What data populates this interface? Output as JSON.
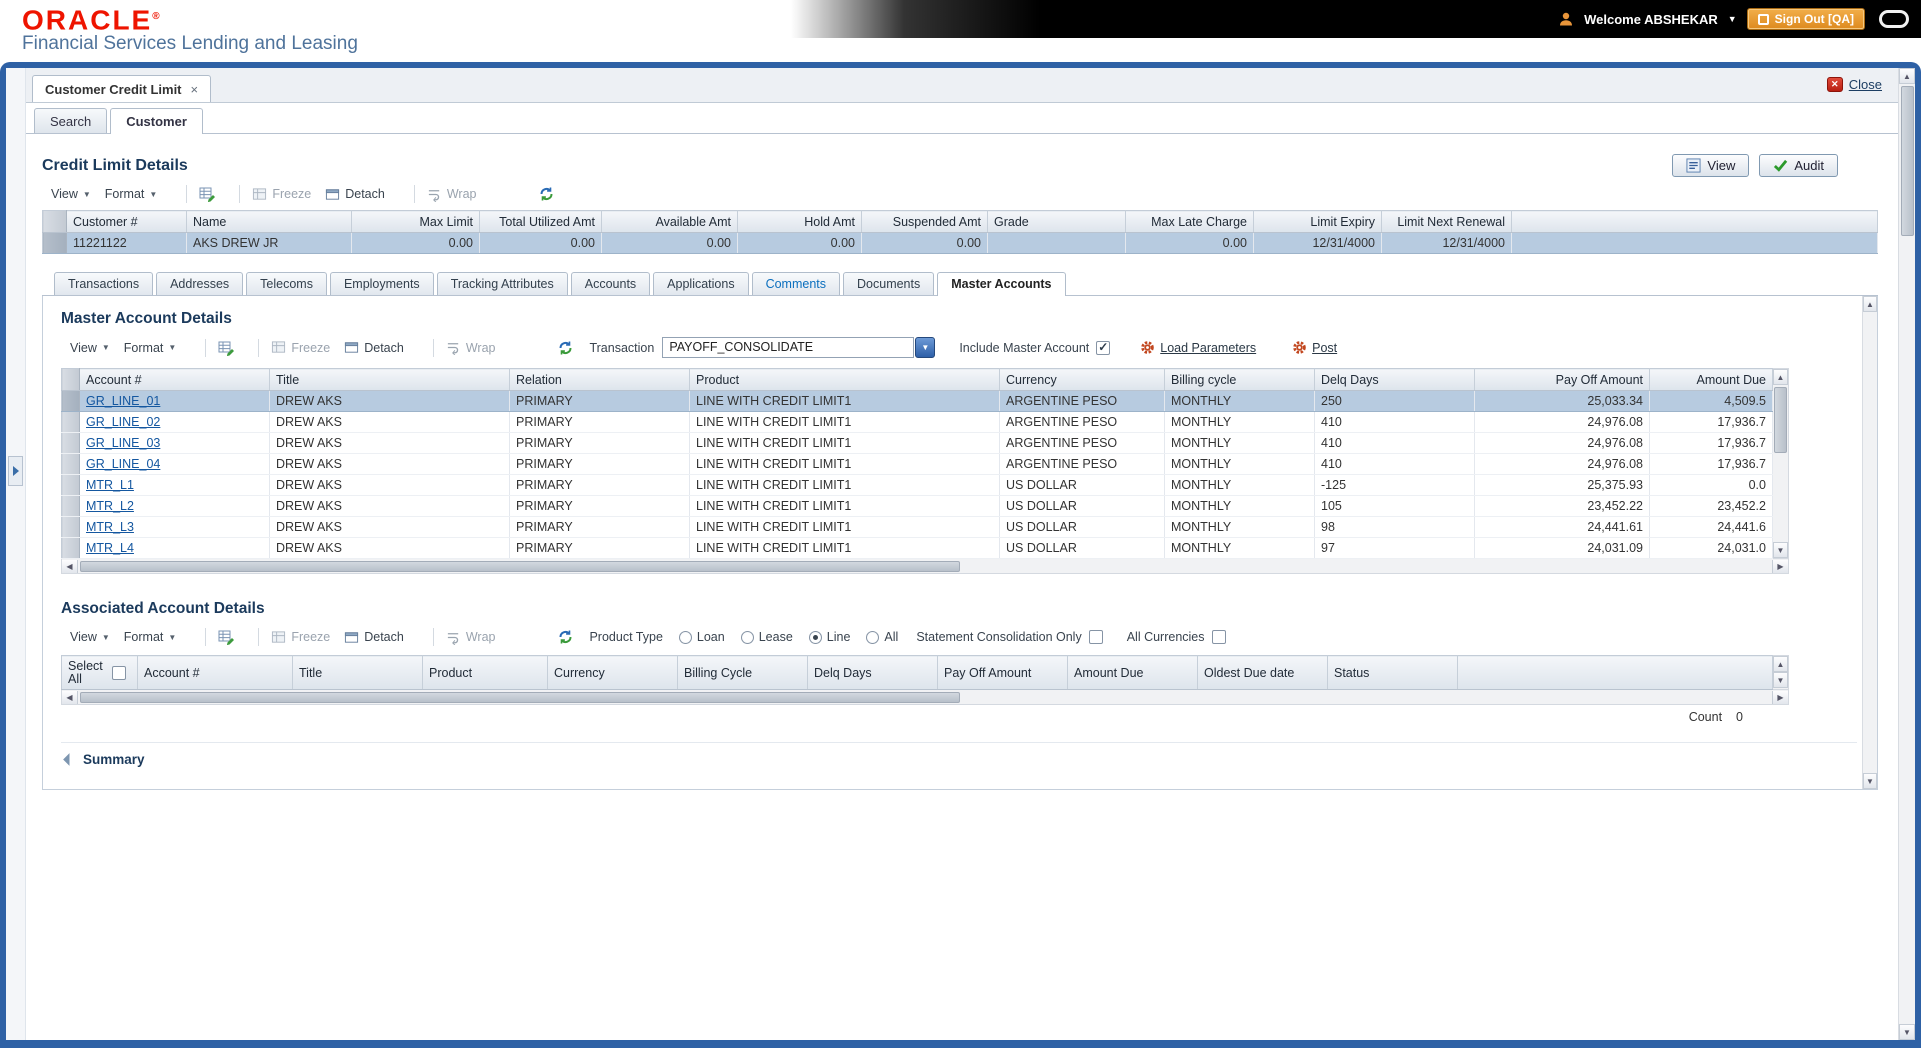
{
  "header": {
    "logo": "ORACLE",
    "registered": "®",
    "subtitle": "Financial Services Lending and Leasing",
    "welcome_label": "Welcome ABSHEKAR",
    "signout_label": "Sign Out [QA]"
  },
  "workspace": {
    "doc_tab": "Customer Credit Limit",
    "close_label": "Close"
  },
  "primary_tabs": {
    "search": "Search",
    "customer": "Customer"
  },
  "toolbar": {
    "view": "View",
    "format": "Format",
    "freeze": "Freeze",
    "detach": "Detach",
    "wrap": "Wrap"
  },
  "credit_limit_details": {
    "title": "Credit Limit Details",
    "view_button": "View",
    "audit_button": "Audit",
    "columns": [
      "Customer #",
      "Name",
      "Max Limit",
      "Total Utilized Amt",
      "Available Amt",
      "Hold Amt",
      "Suspended Amt",
      "Grade",
      "Max Late Charge",
      "Limit Expiry",
      "Limit Next Renewal"
    ],
    "rows": [
      [
        "11221122",
        "AKS DREW JR",
        "0.00",
        "0.00",
        "0.00",
        "0.00",
        "0.00",
        "",
        "0.00",
        "12/31/4000",
        "12/31/4000"
      ]
    ]
  },
  "detail_tabs": [
    {
      "label": "Transactions"
    },
    {
      "label": "Addresses"
    },
    {
      "label": "Telecoms"
    },
    {
      "label": "Employments"
    },
    {
      "label": "Tracking Attributes"
    },
    {
      "label": "Accounts"
    },
    {
      "label": "Applications"
    },
    {
      "label": "Comments",
      "emphasized": true
    },
    {
      "label": "Documents"
    },
    {
      "label": "Master Accounts",
      "active": true
    }
  ],
  "master_account_details": {
    "title": "Master Account Details",
    "transaction_label": "Transaction",
    "transaction_value": "PAYOFF_CONSOLIDATE",
    "include_master_label": "Include Master Account",
    "include_master_checked": true,
    "load_parameters_label": "Load Parameters",
    "post_label": "Post",
    "columns": [
      "Account #",
      "Title",
      "Relation",
      "Product",
      "Currency",
      "Billing cycle",
      "Delq Days",
      "Pay Off Amount",
      "Amount Due"
    ],
    "rows": [
      [
        "GR_LINE_01",
        "DREW AKS",
        "PRIMARY",
        "LINE WITH CREDIT LIMIT1",
        "ARGENTINE PESO",
        "MONTHLY",
        "250",
        "25,033.34",
        "4,509.5"
      ],
      [
        "GR_LINE_02",
        "DREW AKS",
        "PRIMARY",
        "LINE WITH CREDIT LIMIT1",
        "ARGENTINE PESO",
        "MONTHLY",
        "410",
        "24,976.08",
        "17,936.7"
      ],
      [
        "GR_LINE_03",
        "DREW AKS",
        "PRIMARY",
        "LINE WITH CREDIT LIMIT1",
        "ARGENTINE PESO",
        "MONTHLY",
        "410",
        "24,976.08",
        "17,936.7"
      ],
      [
        "GR_LINE_04",
        "DREW AKS",
        "PRIMARY",
        "LINE WITH CREDIT LIMIT1",
        "ARGENTINE PESO",
        "MONTHLY",
        "410",
        "24,976.08",
        "17,936.7"
      ],
      [
        "MTR_L1",
        "DREW AKS",
        "PRIMARY",
        "LINE WITH CREDIT LIMIT1",
        "US DOLLAR",
        "MONTHLY",
        "-125",
        "25,375.93",
        "0.0"
      ],
      [
        "MTR_L2",
        "DREW AKS",
        "PRIMARY",
        "LINE WITH CREDIT LIMIT1",
        "US DOLLAR",
        "MONTHLY",
        "105",
        "23,452.22",
        "23,452.2"
      ],
      [
        "MTR_L3",
        "DREW AKS",
        "PRIMARY",
        "LINE WITH CREDIT LIMIT1",
        "US DOLLAR",
        "MONTHLY",
        "98",
        "24,441.61",
        "24,441.6"
      ],
      [
        "MTR_L4",
        "DREW AKS",
        "PRIMARY",
        "LINE WITH CREDIT LIMIT1",
        "US DOLLAR",
        "MONTHLY",
        "97",
        "24,031.09",
        "24,031.0"
      ]
    ]
  },
  "associated_account_details": {
    "title": "Associated Account Details",
    "product_type_label": "Product Type",
    "product_type_options": [
      "Loan",
      "Lease",
      "Line",
      "All"
    ],
    "product_type_selected": "Line",
    "statement_consolidation_label": "Statement Consolidation Only",
    "statement_consolidation_checked": false,
    "all_currencies_label": "All Currencies",
    "all_currencies_checked": false,
    "select_all_checked": false,
    "columns": [
      "Select All",
      "Account #",
      "Title",
      "Product",
      "Currency",
      "Billing Cycle",
      "Delq Days",
      "Pay Off Amount",
      "Amount Due",
      "Oldest Due date",
      "Status"
    ],
    "rows": [],
    "count_label": "Count",
    "count_value": "0"
  },
  "summary": {
    "title": "Summary"
  },
  "icons": {
    "caret_down": "▼",
    "tab_close": "×",
    "close_x": "✕",
    "scroll_up": "▲",
    "scroll_down": "▼",
    "scroll_left": "◀",
    "scroll_right": "▶"
  },
  "colors": {
    "frame_blue": "#2e61a5",
    "oracle_red": "#ee1400",
    "selected_row": "#b7cbe0",
    "link_blue": "#1457a0",
    "signout_orange": "#dd8a1f",
    "section_title": "#1b3a5c"
  }
}
